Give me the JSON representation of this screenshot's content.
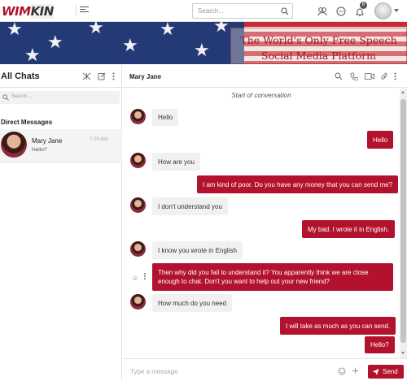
{
  "app": {
    "logo_text_a": "WIM",
    "logo_text_b": "KIN"
  },
  "search": {
    "placeholder": "Search..."
  },
  "notifications": {
    "count": "6"
  },
  "banner": {
    "line1": "The World's Only Free Speech",
    "line2": "Social Media Platform"
  },
  "sidebar": {
    "title": "All Chats",
    "search_placeholder": "Search ...",
    "section": "Direct Messages",
    "conversation": {
      "name": "Mary Jane",
      "time": "7:29 AM",
      "preview": "Hello?"
    }
  },
  "chat": {
    "contact": "Mary Jane",
    "start_label": "Start of conversation",
    "messages": [
      {
        "dir": "in",
        "text": "Hello"
      },
      {
        "dir": "out",
        "text": "Hello"
      },
      {
        "dir": "in",
        "text": "How are you"
      },
      {
        "dir": "out",
        "text": "I am kind of poor. Do you have any money that you can send me?"
      },
      {
        "dir": "in",
        "text": "I don't understand you"
      },
      {
        "dir": "out",
        "text": "My bad. I wrote it in English."
      },
      {
        "dir": "in",
        "text": "I know you wrote in English"
      },
      {
        "dir": "out",
        "text": "Then why did you fail to understand it? You apparently think we are close enough to chat. Don't you want to help out your new friend?"
      },
      {
        "dir": "in",
        "text": "How much do you need"
      },
      {
        "dir": "out",
        "text": "I will take as much as you can send."
      },
      {
        "dir": "out",
        "text": "Hello?"
      }
    ]
  },
  "composer": {
    "placeholder": "Type a message",
    "send_label": "Send"
  },
  "colors": {
    "accent": "#b3122e"
  }
}
